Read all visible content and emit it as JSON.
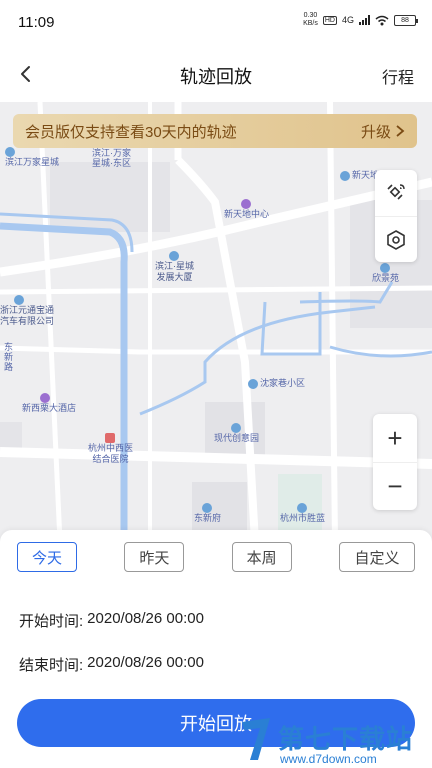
{
  "statusbar": {
    "time": "11:09",
    "netspeed_value": "0.30",
    "netspeed_unit": "KB/s",
    "hd_label": "HD",
    "network_label": "4G",
    "battery_label": "88"
  },
  "navbar": {
    "title": "轨迹回放",
    "action_label": "行程"
  },
  "banner": {
    "message": "会员版仅支持查看30天内的轨迹",
    "upgrade_label": "升级"
  },
  "map": {
    "pois": [
      {
        "label": "滨江万家星城"
      },
      {
        "label": "滨江·万家"
      },
      {
        "label": "星城·东区"
      },
      {
        "label": "新天地"
      },
      {
        "label": "新天地中心"
      },
      {
        "label": "滨江·星城"
      },
      {
        "label": "发展大厦"
      },
      {
        "label": "欣景苑"
      },
      {
        "label": "浙江元通宝通"
      },
      {
        "label": "汽车有限公司"
      },
      {
        "label": "东"
      },
      {
        "label": "新"
      },
      {
        "label": "路"
      },
      {
        "label": "沈家巷小区"
      },
      {
        "label": "新西栗大酒店"
      },
      {
        "label": "现代创意园"
      },
      {
        "label": "杭州中西医"
      },
      {
        "label": "结合医院"
      },
      {
        "label": "东新府"
      },
      {
        "label": "杭州市胜蓝"
      }
    ],
    "zoom_in_label": "+",
    "zoom_out_label": "−"
  },
  "tabs": [
    {
      "label": "今天",
      "active": true
    },
    {
      "label": "昨天",
      "active": false
    },
    {
      "label": "本周",
      "active": false
    },
    {
      "label": "自定义",
      "active": false
    }
  ],
  "start_time": {
    "label": "开始时间:",
    "value": "2020/08/26 00:00"
  },
  "end_time": {
    "label": "结束时间:",
    "value": "2020/08/26 00:00"
  },
  "start_button_label": "开始回放",
  "watermark": {
    "title": "第七下载站",
    "url": "www.d7down.com"
  },
  "colors": {
    "accent": "#2f6ded",
    "banner_text": "#7a4b14",
    "water": "#a8c8f0"
  }
}
